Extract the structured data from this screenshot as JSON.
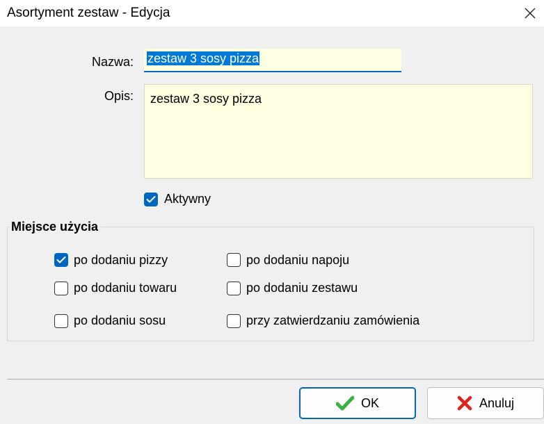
{
  "dialog": {
    "title": "Asortyment zestaw - Edycja"
  },
  "form": {
    "name_label": "Nazwa:",
    "name_value": "zestaw 3 sosy pizza",
    "desc_label": "Opis:",
    "desc_value": "zestaw 3 sosy pizza",
    "active_label": "Aktywny",
    "active_checked": true
  },
  "usage": {
    "title": "Miejsce użycia",
    "options": [
      {
        "label": "po dodaniu pizzy",
        "checked": true
      },
      {
        "label": "po dodaniu towaru",
        "checked": false
      },
      {
        "label": "po dodaniu sosu",
        "checked": false
      },
      {
        "label": "po dodaniu napoju",
        "checked": false
      },
      {
        "label": "po dodaniu zestawu",
        "checked": false
      },
      {
        "label": "przy zatwierdzaniu zamówienia",
        "checked": false
      }
    ]
  },
  "buttons": {
    "ok_label": "OK",
    "cancel_label": "Anuluj"
  },
  "colors": {
    "accent": "#0067c0",
    "input_bg": "#ffffe1",
    "ok_icon": "#3cb043",
    "cancel_icon": "#e0201b"
  },
  "icons": {
    "close": "close-icon",
    "ok": "checkmark-icon",
    "cancel": "x-icon"
  }
}
